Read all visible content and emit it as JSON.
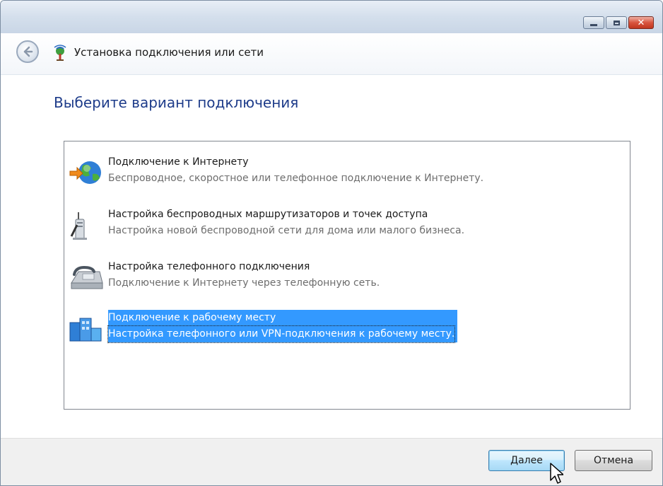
{
  "window": {
    "title": "Установка подключения или сети",
    "controls": [
      "minimize-icon",
      "maximize-icon",
      "close-icon"
    ]
  },
  "heading": "Выберите вариант подключения",
  "options": [
    {
      "title": "Подключение к Интернету",
      "description": "Беспроводное, скоростное или телефонное подключение к Интернету.",
      "icon": "globe-icon",
      "selected": false
    },
    {
      "title": "Настройка беспроводных маршрутизаторов и точек доступа",
      "description": "Настройка новой беспроводной сети для дома или малого бизнеса.",
      "icon": "wireless-router-icon",
      "selected": false
    },
    {
      "title": "Настройка телефонного подключения",
      "description": "Подключение к Интернету через телефонную сеть.",
      "icon": "telephone-icon",
      "selected": false
    },
    {
      "title": "Подключение к рабочему месту",
      "description": "Настройка телефонного или VPN-подключения к рабочему месту.",
      "icon": "workplace-icon",
      "selected": true
    }
  ],
  "buttons": {
    "next": "Далее",
    "cancel": "Отмена"
  },
  "colors": {
    "heading": "#1e3c8a",
    "selection": "#3399ff"
  }
}
